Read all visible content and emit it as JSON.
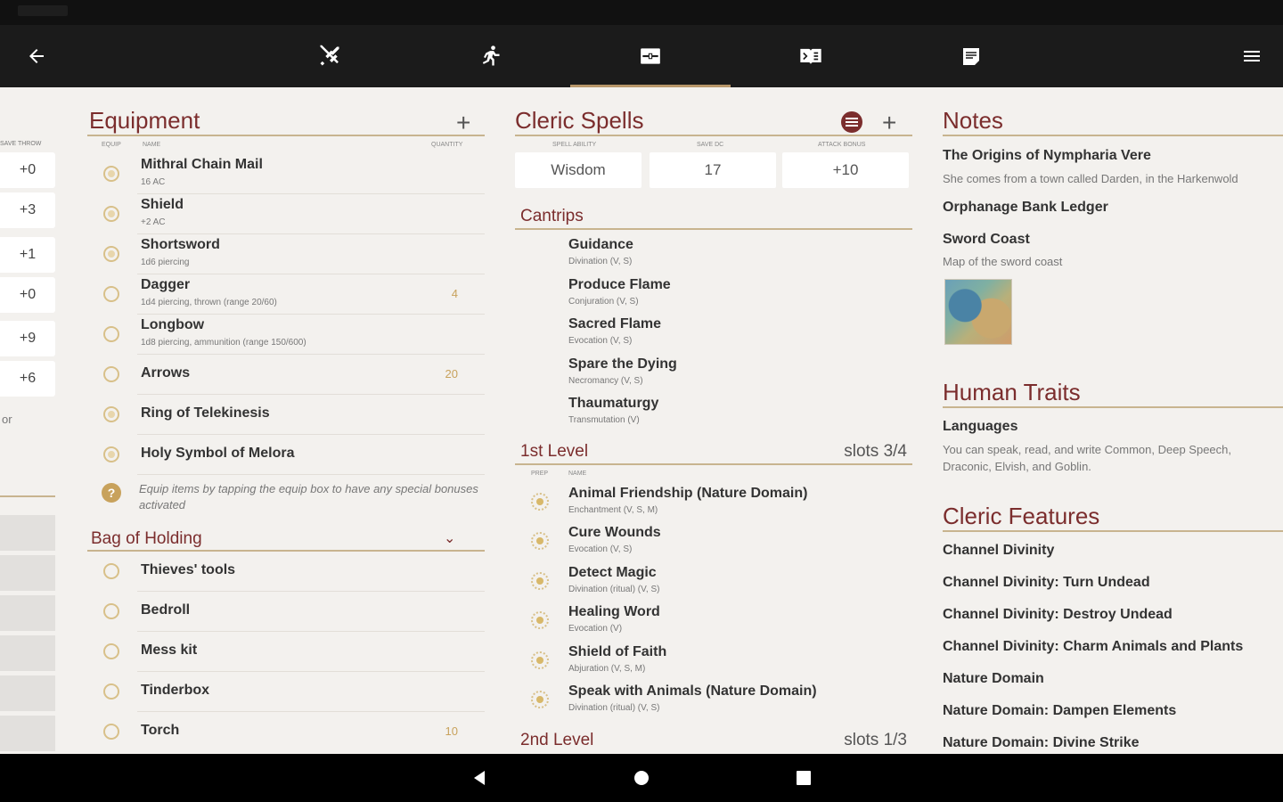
{
  "toolbar": {
    "back_icon": "arrow-left-icon",
    "tabs": [
      {
        "icon": "crossed-swords-icon",
        "active": false
      },
      {
        "icon": "running-figure-icon",
        "active": false
      },
      {
        "icon": "inventory-chest-icon",
        "active": true
      },
      {
        "icon": "spellbook-icon",
        "active": false
      },
      {
        "icon": "notes-icon",
        "active": false
      }
    ],
    "menu_icon": "hamburger-menu-icon"
  },
  "saves": {
    "header": "SAVE THROW",
    "values": [
      "+0",
      "+3",
      "+1",
      "+0",
      "+9",
      "+6"
    ],
    "footer_text": "or"
  },
  "equipment": {
    "title": "Equipment",
    "add_label": "+",
    "headers": {
      "equip": "EQUIP",
      "name": "NAME",
      "quantity": "QUANTITY"
    },
    "items": [
      {
        "name": "Mithral Chain Mail",
        "sub": "16 AC",
        "qty": ""
      },
      {
        "name": "Shield",
        "sub": "+2 AC",
        "qty": ""
      },
      {
        "name": "Shortsword",
        "sub": "1d6 piercing",
        "qty": ""
      },
      {
        "name": "Dagger",
        "sub": "1d4 piercing, thrown (range 20/60)",
        "qty": "4"
      },
      {
        "name": "Longbow",
        "sub": "1d8 piercing, ammunition (range 150/600)",
        "qty": ""
      },
      {
        "name": "Arrows",
        "sub": "",
        "qty": "20"
      },
      {
        "name": "Ring of Telekinesis",
        "sub": "",
        "qty": ""
      },
      {
        "name": "Holy Symbol of Melora",
        "sub": "",
        "qty": ""
      }
    ],
    "hint": "Equip items by tapping the equip box to have any special bonuses activated",
    "bag": {
      "title": "Bag of Holding",
      "items": [
        {
          "name": "Thieves' tools",
          "qty": ""
        },
        {
          "name": "Bedroll",
          "qty": ""
        },
        {
          "name": "Mess kit",
          "qty": ""
        },
        {
          "name": "Tinderbox",
          "qty": ""
        },
        {
          "name": "Torch",
          "qty": "10"
        }
      ]
    }
  },
  "spells": {
    "title": "Cleric Spells",
    "add_label": "+",
    "stat_headers": [
      "SPELL ABILITY",
      "SAVE DC",
      "ATTACK BONUS"
    ],
    "stats": [
      "Wisdom",
      "17",
      "+10"
    ],
    "cantrips": {
      "title": "Cantrips",
      "items": [
        {
          "name": "Guidance",
          "sub": "Divination (V, S)"
        },
        {
          "name": "Produce Flame",
          "sub": "Conjuration (V, S)"
        },
        {
          "name": "Sacred Flame",
          "sub": "Evocation (V, S)"
        },
        {
          "name": "Spare the Dying",
          "sub": "Necromancy (V, S)"
        },
        {
          "name": "Thaumaturgy",
          "sub": "Transmutation (V)"
        }
      ]
    },
    "level1": {
      "title": "1st Level",
      "slots": "slots 3/4",
      "headers": {
        "prep": "PREP",
        "name": "NAME"
      },
      "items": [
        {
          "name": "Animal Friendship (Nature Domain)",
          "sub": "Enchantment (V, S, M)"
        },
        {
          "name": "Cure Wounds",
          "sub": "Evocation (V, S)"
        },
        {
          "name": "Detect Magic",
          "sub": "Divination (ritual) (V, S)"
        },
        {
          "name": "Healing Word",
          "sub": "Evocation (V)"
        },
        {
          "name": "Shield of Faith",
          "sub": "Abjuration (V, S, M)"
        },
        {
          "name": "Speak with Animals (Nature Domain)",
          "sub": "Divination (ritual) (V, S)"
        }
      ]
    },
    "level2": {
      "title": "2nd Level",
      "slots": "slots 1/3"
    }
  },
  "notes": {
    "title": "Notes",
    "items": [
      {
        "name": "The Origins of Nympharia Vere",
        "sub": "She comes from a town called Darden, in the Harkenwold"
      },
      {
        "name": "Orphanage Bank Ledger",
        "sub": ""
      },
      {
        "name": "Sword Coast",
        "sub": "Map of the sword coast"
      }
    ]
  },
  "traits": {
    "title": "Human Traits",
    "languages_name": "Languages",
    "languages_text": "You can speak, read, and write Common, Deep Speech, Draconic, Elvish, and Goblin."
  },
  "features": {
    "title": "Cleric Features",
    "items": [
      "Channel Divinity",
      "Channel Divinity: Turn Undead",
      "Channel Divinity: Destroy Undead",
      "Channel Divinity: Charm Animals and Plants",
      "Nature Domain",
      "Nature Domain: Dampen Elements",
      "Nature Domain: Divine Strike"
    ]
  },
  "navbar": {
    "back_icon": "nav-back-triangle-icon",
    "home_icon": "nav-home-circle-icon",
    "recents_icon": "nav-recents-square-icon"
  },
  "colors": {
    "accent": "#7b2d2d",
    "gold": "#c8b48f",
    "bar": "#1b1b1b",
    "background": "#f3f1ee"
  }
}
